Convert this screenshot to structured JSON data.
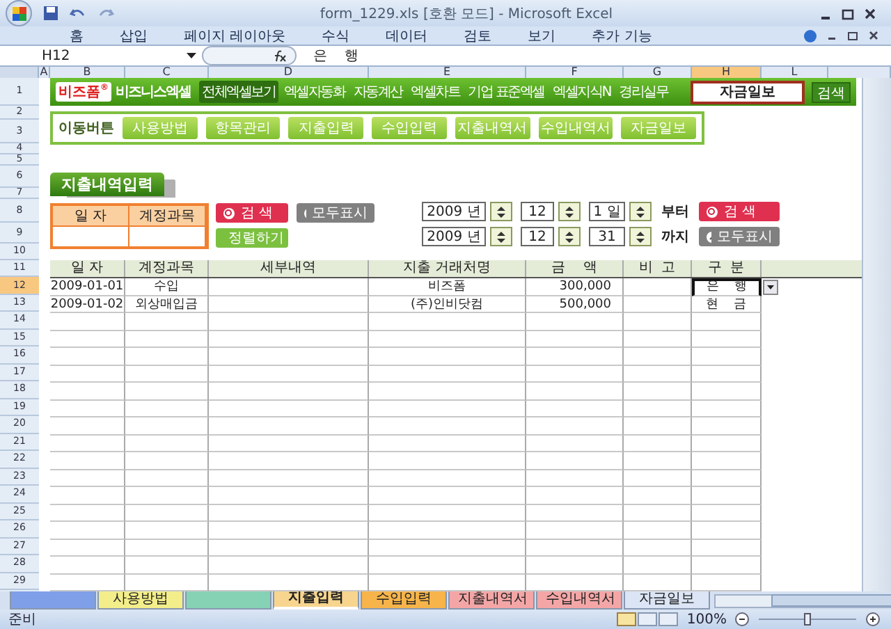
{
  "window": {
    "title": "form_1229.xls  [호환 모드] - Microsoft Excel"
  },
  "ribbon_tabs": [
    "홈",
    "삽입",
    "페이지 레이아웃",
    "수식",
    "데이터",
    "검토",
    "보기",
    "추가 기능"
  ],
  "formula_bar": {
    "name_box": "H12",
    "value": "은    행"
  },
  "columns": [
    {
      "label": "A",
      "selected": false
    },
    {
      "label": "B",
      "selected": false
    },
    {
      "label": "C",
      "selected": false
    },
    {
      "label": "D",
      "selected": false
    },
    {
      "label": "E",
      "selected": false
    },
    {
      "label": "F",
      "selected": false
    },
    {
      "label": "G",
      "selected": false
    },
    {
      "label": "H",
      "selected": true
    },
    {
      "label": "L",
      "selected": false
    }
  ],
  "row_headers": [
    {
      "label": "1",
      "selected": false
    },
    {
      "label": "2",
      "selected": false
    },
    {
      "label": "3",
      "selected": false
    },
    {
      "label": "4",
      "selected": false
    },
    {
      "label": "5",
      "selected": false
    },
    {
      "label": "6",
      "selected": false
    },
    {
      "label": "7",
      "selected": false
    },
    {
      "label": "8",
      "selected": false
    },
    {
      "label": "9",
      "selected": false
    },
    {
      "label": "10",
      "selected": false
    },
    {
      "label": "11",
      "selected": false
    },
    {
      "label": "12",
      "selected": true
    },
    {
      "label": "13",
      "selected": false
    },
    {
      "label": "14",
      "selected": false
    },
    {
      "label": "15",
      "selected": false
    },
    {
      "label": "16",
      "selected": false
    },
    {
      "label": "17",
      "selected": false
    },
    {
      "label": "18",
      "selected": false
    },
    {
      "label": "19",
      "selected": false
    },
    {
      "label": "20",
      "selected": false
    },
    {
      "label": "21",
      "selected": false
    },
    {
      "label": "22",
      "selected": false
    },
    {
      "label": "23",
      "selected": false
    },
    {
      "label": "24",
      "selected": false
    },
    {
      "label": "25",
      "selected": false
    },
    {
      "label": "26",
      "selected": false
    },
    {
      "label": "27",
      "selected": false
    },
    {
      "label": "28",
      "selected": false
    },
    {
      "label": "29",
      "selected": false
    }
  ],
  "banner": {
    "logo": "비즈폼",
    "logo_mark": "®",
    "logo2": "비즈니스엑셀",
    "menu": [
      {
        "label": "전체엑셀보기",
        "selected": true
      },
      {
        "label": "엑셀자동화",
        "selected": false
      },
      {
        "label": "자동계산",
        "selected": false
      },
      {
        "label": "엑셀차트",
        "selected": false
      },
      {
        "label": "기업 표준엑셀",
        "selected": false
      },
      {
        "label": "엑셀지식N",
        "selected": false
      },
      {
        "label": "경리실무",
        "selected": false
      }
    ],
    "search_value": "자금일보",
    "search_button": "검색"
  },
  "nav": {
    "label": "이동버튼",
    "buttons": [
      "사용방법",
      "항목관리",
      "지출입력",
      "수입입력",
      "지출내역서",
      "수입내역서",
      "자금일보"
    ]
  },
  "section_title": "지출내역입력",
  "filter": {
    "headers": [
      "일 자",
      "계정과목"
    ],
    "search": "검 색",
    "show_all": "모두표시",
    "sort": "정렬하기"
  },
  "date_range": [
    {
      "year": "2009 년",
      "month": "12",
      "day": "1 일",
      "suffix": "부터",
      "button": "검 색",
      "kind": "search"
    },
    {
      "year": "2009 년",
      "month": "12",
      "day": "31",
      "suffix": "까지",
      "button": "모두표시",
      "kind": "show_all"
    }
  ],
  "table": {
    "columns": [
      "일 자",
      "계정과목",
      "세부내역",
      "지출 거래처명",
      "금    액",
      "비  고",
      "구  분"
    ],
    "rows": [
      {
        "cells": [
          "2009-01-01",
          "수입",
          "",
          "비즈폼",
          "300,000",
          "",
          "은    행"
        ],
        "selected": true
      },
      {
        "cells": [
          "2009-01-02",
          "외상매입금",
          "",
          "(주)인비닷컴",
          "500,000",
          "",
          "현    금"
        ],
        "selected": false
      }
    ]
  },
  "sheet_tabs": [
    {
      "color": "#7f9fe8",
      "selected": false
    },
    {
      "label": "사용방법",
      "color": "#f3ee8a",
      "selected": false
    },
    {
      "color": "#86d2b4",
      "selected": false
    },
    {
      "label": "지출입력",
      "color": "#f7d58e",
      "selected": true
    },
    {
      "label": "수입입력",
      "color": "#f6b44a",
      "selected": false
    },
    {
      "label": "지출내역서",
      "color": "#f4a6a6",
      "selected": false
    },
    {
      "label": "수입내역서",
      "color": "#f4a6a6",
      "selected": false
    },
    {
      "label": "자금일보",
      "color": "#dbe5f5",
      "selected": false
    }
  ],
  "status_bar": {
    "mode": "준비",
    "zoom": "100%",
    "zoom_slider": {
      "level": 0.5
    }
  }
}
